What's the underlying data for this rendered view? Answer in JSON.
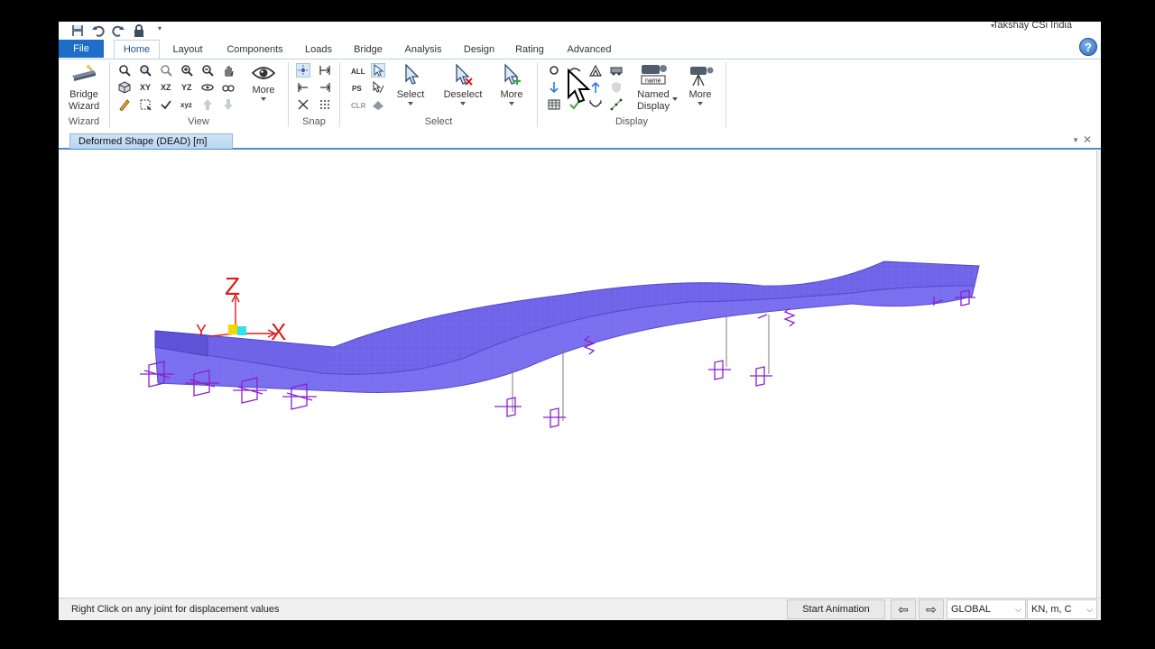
{
  "window": {
    "user_label": "Takshay CSi India"
  },
  "tabs": [
    "File",
    "Home",
    "Layout",
    "Components",
    "Loads",
    "Bridge",
    "Analysis",
    "Design",
    "Rating",
    "Advanced"
  ],
  "ribbon": {
    "bridge_wizard": {
      "line1": "Bridge",
      "line2": "Wizard",
      "group": "Wizard"
    },
    "view": {
      "group": "View",
      "more": "More",
      "xy": "XY",
      "xz": "XZ",
      "yz": "YZ"
    },
    "snap": {
      "group": "Snap"
    },
    "select": {
      "group": "Select",
      "all": "ALL",
      "ps": "PS",
      "clr": "CLR",
      "select": "Select",
      "deselect": "Deselect",
      "more": "More"
    },
    "display": {
      "group": "Display",
      "named_line1": "Named",
      "named_line2": "Display",
      "name_tag": "name",
      "more": "More"
    }
  },
  "document": {
    "tab_title": "Deformed Shape (DEAD)  [m]"
  },
  "model": {
    "axis_z": "Z",
    "axis_x": "X",
    "axis_y": "Y",
    "deck_color": "#6f63e8",
    "support_color": "#8a1fd0",
    "axis_color": "#dd1a1a"
  },
  "status": {
    "message": "Right Click on any joint for displacement values",
    "start_animation": "Start Animation",
    "coord_system": "GLOBAL",
    "units": "KN, m, C"
  }
}
